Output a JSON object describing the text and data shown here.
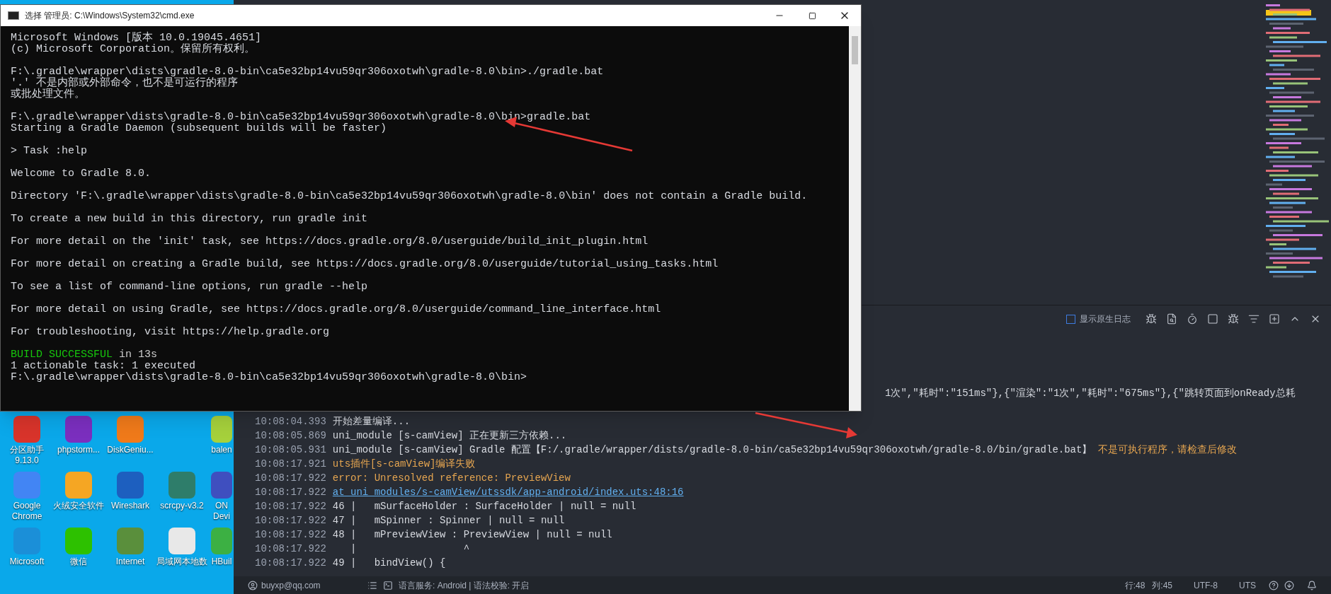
{
  "desktop": {
    "rows": [
      [
        {
          "label": "分区助手 9.13.0",
          "color": "#d9342b"
        },
        {
          "label": "phpstorm...",
          "color": "#7b2fbf"
        },
        {
          "label": "DiskGeniu...",
          "color": "#f07a1a"
        },
        "",
        {
          "label": "balen",
          "color": "#a6d13c"
        }
      ],
      [
        {
          "label": "Google Chrome",
          "color": "#4285f4"
        },
        {
          "label": "火绒安全软件",
          "color": "#f5a623"
        },
        {
          "label": "Wireshark",
          "color": "#1d5fbf"
        },
        {
          "label": "scrcpy-v3.2",
          "color": "#2e7d6a"
        },
        {
          "label": "ON Devi",
          "color": "#3f4fbf"
        }
      ],
      [
        {
          "label": "Microsoft",
          "color": "#1b8fd8"
        },
        {
          "label": "微信",
          "color": "#2dc100"
        },
        {
          "label": "Internet",
          "color": "#5a8f3c"
        },
        {
          "label": "局域网本地数",
          "color": "#e8e8e8"
        },
        {
          "label": "HBuil",
          "color": "#3cb043"
        }
      ]
    ]
  },
  "ide": {
    "console": {
      "native_log": {
        "label": "显示原生日志",
        "checked": false
      },
      "lines": [
        {
          "kind": "fragment",
          "segments": [
            {
              "text": "1次\",\"耗时\":\"151ms\"},{\"渲染\":\"1次\",\"耗时\":\"675ms\"},{\"跳转页面到onReady总耗",
              "kind": "plain"
            }
          ]
        },
        {
          "kind": "log",
          "time": "10:08:04.393",
          "segments": [
            {
              "text": "开始差量编译...",
              "kind": "plain"
            }
          ]
        },
        {
          "kind": "log",
          "time": "10:08:05.869",
          "segments": [
            {
              "text": "uni_module [s-camView] 正在更新三方依赖...",
              "kind": "plain"
            }
          ]
        },
        {
          "kind": "log",
          "time": "10:08:05.931",
          "segments": [
            {
              "text": "uni_module [s-camView] Gradle 配置【F:/.gradle/wrapper/dists/gradle-8.0-bin/ca5e32bp14vu59qr306oxotwh/gradle-8.0/bin/gradle.bat】",
              "kind": "plain"
            },
            {
              "text": "不是可执行程序，请检查后修改",
              "kind": "warn"
            }
          ]
        },
        {
          "kind": "log",
          "time": "10:08:17.921",
          "segments": [
            {
              "text": "uts插件[s-camView]编译失败",
              "kind": "warn"
            }
          ]
        },
        {
          "kind": "log",
          "time": "10:08:17.922",
          "segments": [
            {
              "text": "error: Unresolved reference: PreviewView",
              "kind": "warn"
            }
          ]
        },
        {
          "kind": "log",
          "time": "10:08:17.922",
          "segments": [
            {
              "text": "at uni_modules/s-camView/utssdk/app-android/index.uts:48:16",
              "kind": "link"
            }
          ]
        },
        {
          "kind": "log",
          "time": "10:08:17.922",
          "segments": [
            {
              "text": "46 |   mSurfaceHolder : SurfaceHolder | null = null",
              "kind": "plain"
            }
          ]
        },
        {
          "kind": "log",
          "time": "10:08:17.922",
          "segments": [
            {
              "text": "47 |   mSpinner : Spinner | null = null",
              "kind": "plain"
            }
          ]
        },
        {
          "kind": "log",
          "time": "10:08:17.922",
          "segments": [
            {
              "text": "48 |   mPreviewView : PreviewView | null = null",
              "kind": "plain"
            }
          ]
        },
        {
          "kind": "log",
          "time": "10:08:17.922",
          "segments": [
            {
              "text": "   |                  ^",
              "kind": "plain"
            }
          ]
        },
        {
          "kind": "log",
          "time": "10:08:17.922",
          "segments": [
            {
              "text": "49 |   bindView() {",
              "kind": "plain"
            }
          ]
        }
      ]
    },
    "status_bar": {
      "user": "buyxp@qq.com",
      "language": "语言服务: Android | 语法校验: 开启",
      "line": "行:48",
      "column": "列:45",
      "encoding": "UTF-8",
      "mode": "UTS"
    }
  },
  "cmd_window": {
    "title": "选择 管理员: C:\\Windows\\System32\\cmd.exe",
    "lines": [
      {
        "text": "Microsoft Windows [版本 10.0.19045.4651]",
        "kind": "plain",
        "space_before": false
      },
      {
        "text": "(c) Microsoft Corporation。保留所有权利。",
        "kind": "plain",
        "space_before": false
      },
      {
        "text": "F:\\.gradle\\wrapper\\dists\\gradle-8.0-bin\\ca5e32bp14vu59qr306oxotwh\\gradle-8.0\\bin>./gradle.bat",
        "kind": "plain",
        "space_before": true
      },
      {
        "text": "'.' 不是内部或外部命令，也不是可运行的程序",
        "kind": "plain",
        "space_before": false
      },
      {
        "text": "或批处理文件。",
        "kind": "plain",
        "space_before": false
      },
      {
        "text": "F:\\.gradle\\wrapper\\dists\\gradle-8.0-bin\\ca5e32bp14vu59qr306oxotwh\\gradle-8.0\\bin>gradle.bat",
        "kind": "plain",
        "space_before": true
      },
      {
        "text": "Starting a Gradle Daemon (subsequent builds will be faster)",
        "kind": "plain",
        "space_before": false
      },
      {
        "text": "> Task :help",
        "kind": "plain",
        "space_before": true
      },
      {
        "text": "Welcome to Gradle 8.0.",
        "kind": "plain",
        "space_before": true
      },
      {
        "text": "Directory 'F:\\.gradle\\wrapper\\dists\\gradle-8.0-bin\\ca5e32bp14vu59qr306oxotwh\\gradle-8.0\\bin' does not contain a Gradle build.",
        "kind": "plain",
        "space_before": true
      },
      {
        "text": "To create a new build in this directory, run gradle init",
        "kind": "plain",
        "space_before": true
      },
      {
        "text": "For more detail on the 'init' task, see https://docs.gradle.org/8.0/userguide/build_init_plugin.html",
        "kind": "plain",
        "space_before": true
      },
      {
        "text": "For more detail on creating a Gradle build, see https://docs.gradle.org/8.0/userguide/tutorial_using_tasks.html",
        "kind": "plain",
        "space_before": true
      },
      {
        "text": "To see a list of command-line options, run gradle --help",
        "kind": "plain",
        "space_before": true
      },
      {
        "text": "For more detail on using Gradle, see https://docs.gradle.org/8.0/userguide/command_line_interface.html",
        "kind": "plain",
        "space_before": true
      },
      {
        "text": "For troubleshooting, visit https://help.gradle.org",
        "kind": "plain",
        "space_before": true
      },
      {
        "text": "BUILD SUCCESSFUL",
        "kind": "success",
        "space_before": true,
        "suffix": " in 13s"
      },
      {
        "text": "1 actionable task: 1 executed",
        "kind": "plain",
        "space_before": false
      },
      {
        "text": "F:\\.gradle\\wrapper\\dists\\gradle-8.0-bin\\ca5e32bp14vu59qr306oxotwh\\gradle-8.0\\bin>",
        "kind": "plain",
        "space_before": false
      }
    ]
  }
}
